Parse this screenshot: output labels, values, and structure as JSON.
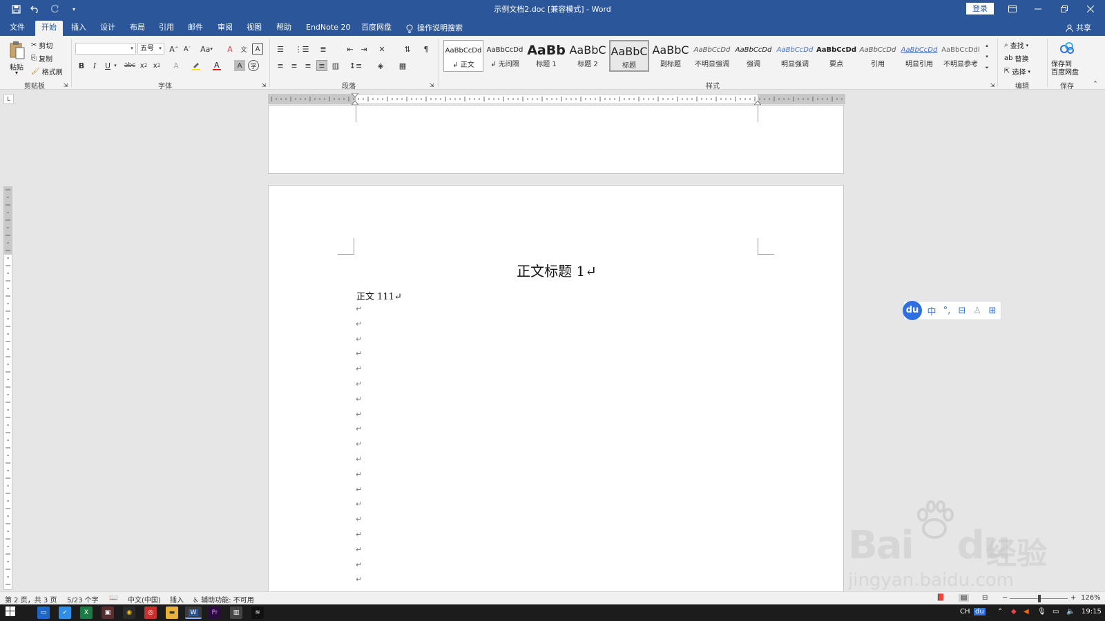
{
  "titlebar": {
    "doc_title": "示例文档2.doc [兼容模式]  -  Word",
    "login_label": "登录"
  },
  "tabs": {
    "items": [
      {
        "label": "文件"
      },
      {
        "label": "开始"
      },
      {
        "label": "插入"
      },
      {
        "label": "设计"
      },
      {
        "label": "布局"
      },
      {
        "label": "引用"
      },
      {
        "label": "邮件"
      },
      {
        "label": "审阅"
      },
      {
        "label": "视图"
      },
      {
        "label": "帮助"
      },
      {
        "label": "EndNote 20"
      },
      {
        "label": "百度网盘"
      }
    ],
    "tell_me": "操作说明搜索",
    "share": "共享"
  },
  "ribbon": {
    "clipboard": {
      "paste": "粘贴",
      "cut": "剪切",
      "copy": "复制",
      "format_painter": "格式刷",
      "label": "剪贴板"
    },
    "font": {
      "font_name": "",
      "font_size": "五号",
      "label": "字体",
      "change_case": "Aa"
    },
    "paragraph": {
      "label": "段落"
    },
    "styles": {
      "label": "样式",
      "items": [
        {
          "preview": "AaBbCcDd",
          "name": "↲ 正文"
        },
        {
          "preview": "AaBbCcDd",
          "name": "↲ 无间隔"
        },
        {
          "preview": "AaBb",
          "name": "标题 1"
        },
        {
          "preview": "AaBbC",
          "name": "标题 2"
        },
        {
          "preview": "AaBbC",
          "name": "标题"
        },
        {
          "preview": "AaBbC",
          "name": "副标题"
        },
        {
          "preview": "AaBbCcDd",
          "name": "不明显强调"
        },
        {
          "preview": "AaBbCcDd",
          "name": "强调"
        },
        {
          "preview": "AaBbCcDd",
          "name": "明显强调"
        },
        {
          "preview": "AaBbCcDd",
          "name": "要点"
        },
        {
          "preview": "AaBbCcDd",
          "name": "引用"
        },
        {
          "preview": "AaBbCcDd",
          "name": "明显引用"
        },
        {
          "preview": "AaBbCcDdI",
          "name": "不明显参考"
        }
      ]
    },
    "editing": {
      "find": "查找",
      "replace": "替换",
      "select": "选择",
      "label": "编辑"
    },
    "save": {
      "save_to": "保存到",
      "baidu_pan": "百度网盘",
      "label": "保存"
    }
  },
  "document": {
    "heading": "正文标题 1↵",
    "body_line": "正文 111↵",
    "para_mark": "↵"
  },
  "ime": {
    "logo": "du",
    "lang": "中"
  },
  "watermark": {
    "brand": "Bai",
    "brand2": "du",
    "cn": "经验",
    "url": "jingyan.baidu.com"
  },
  "statusbar": {
    "page": "第 2 页，共 3 页",
    "words": "5/23 个字",
    "language": "中文(中国)",
    "mode": "插入",
    "accessibility": "辅助功能: 不可用",
    "zoom": "126%"
  },
  "taskbar": {
    "ime_lang": "CH",
    "time": "19:15"
  },
  "colors": {
    "word_blue": "#2b579a",
    "ribbon_bg": "#f3f3f3",
    "taskbar_bg": "#1c1c1c"
  }
}
